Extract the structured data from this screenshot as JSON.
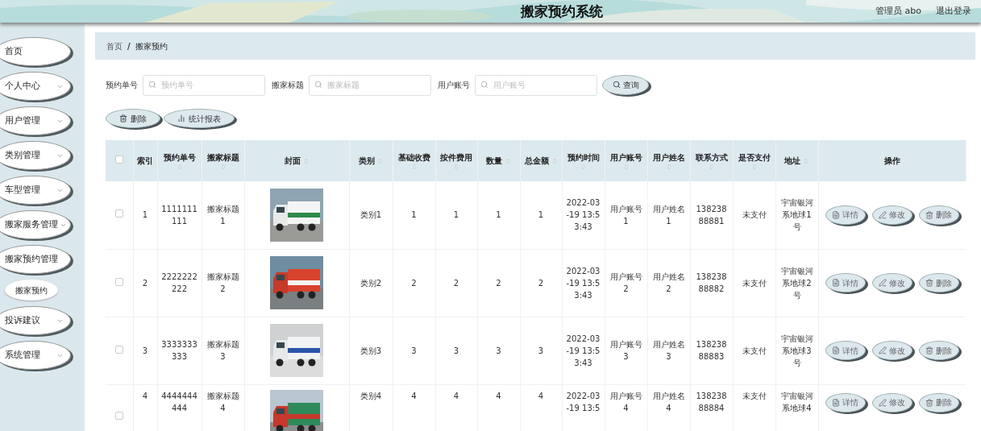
{
  "header": {
    "title": "搬家预约系统",
    "user": "管理员 abo",
    "logout": "退出登录"
  },
  "sidebar": {
    "items": [
      {
        "label": "首页",
        "kind": "link"
      },
      {
        "label": "个人中心",
        "kind": "menu",
        "expanded": false
      },
      {
        "label": "用户管理",
        "kind": "menu",
        "expanded": false
      },
      {
        "label": "类别管理",
        "kind": "menu",
        "expanded": false
      },
      {
        "label": "车型管理",
        "kind": "menu",
        "expanded": false
      },
      {
        "label": "搬家服务管理",
        "kind": "menu",
        "expanded": false
      },
      {
        "label": "搬家预约管理",
        "kind": "menu",
        "expanded": true,
        "children": [
          {
            "label": "搬家预约",
            "selected": true
          }
        ]
      },
      {
        "label": "投诉建议",
        "kind": "menu",
        "expanded": false
      },
      {
        "label": "系统管理",
        "kind": "menu",
        "expanded": false
      }
    ]
  },
  "breadcrumb": [
    "首页",
    "搬家预约"
  ],
  "breadcrumb_separator": "/",
  "search": {
    "fields": [
      {
        "label": "预约单号",
        "placeholder": "预约单号"
      },
      {
        "label": "搬家标题",
        "placeholder": "搬家标题"
      },
      {
        "label": "用户账号",
        "placeholder": "用户账号"
      }
    ],
    "button": "查询"
  },
  "toolbar": [
    {
      "label": "删除",
      "kind": "delete"
    },
    {
      "label": "统计报表",
      "kind": "chart"
    }
  ],
  "table": {
    "select_all_checked": false,
    "columns": [
      {
        "label": "索引",
        "sortable": false
      },
      {
        "label": "预约单号",
        "sortable": true
      },
      {
        "label": "搬家标题",
        "sortable": true
      },
      {
        "label": "封面",
        "sortable": true
      },
      {
        "label": "类别",
        "sortable": true
      },
      {
        "label": "基础收费",
        "sortable": true
      },
      {
        "label": "按件费用",
        "sortable": true
      },
      {
        "label": "数量",
        "sortable": true
      },
      {
        "label": "总金额",
        "sortable": true
      },
      {
        "label": "预约时间",
        "sortable": true
      },
      {
        "label": "用户账号",
        "sortable": true
      },
      {
        "label": "用户姓名",
        "sortable": true
      },
      {
        "label": "联系方式",
        "sortable": true
      },
      {
        "label": "是否支付",
        "sortable": true
      },
      {
        "label": "地址",
        "sortable": true
      },
      {
        "label": "操作",
        "sortable": false
      }
    ],
    "rows": [
      {
        "checked": false,
        "cells": [
          "1",
          "1111111111",
          "搬家标题1",
          {
            "kind": "picture"
          },
          "类别1",
          "1",
          "1",
          "1",
          "1",
          "2022-03-19 13:53:43",
          "用户账号1",
          "用户姓名1",
          "13823888881",
          "未支付",
          "宇宙银河系地球1号"
        ],
        "actions": [
          {
            "label": "详情",
            "kind": "detail"
          },
          {
            "label": "修改",
            "kind": "edit"
          },
          {
            "label": "删除",
            "kind": "delete"
          }
        ]
      },
      {
        "checked": false,
        "cells": [
          "2",
          "2222222222",
          "搬家标题2",
          {
            "kind": "picture"
          },
          "类别2",
          "2",
          "2",
          "2",
          "2",
          "2022-03-19 13:53:43",
          "用户账号2",
          "用户姓名2",
          "13823888882",
          "未支付",
          "宇宙银河系地球2号"
        ],
        "actions": [
          {
            "label": "详情",
            "kind": "detail"
          },
          {
            "label": "修改",
            "kind": "edit"
          },
          {
            "label": "删除",
            "kind": "delete"
          }
        ]
      },
      {
        "checked": false,
        "cells": [
          "3",
          "3333333333",
          "搬家标题3",
          {
            "kind": "picture"
          },
          "类别3",
          "3",
          "3",
          "3",
          "3",
          "2022-03-19 13:53:43",
          "用户账号3",
          "用户姓名3",
          "13823888883",
          "未支付",
          "宇宙银河系地球3号"
        ],
        "actions": [
          {
            "label": "详情",
            "kind": "detail"
          },
          {
            "label": "修改",
            "kind": "edit"
          },
          {
            "label": "删除",
            "kind": "delete"
          }
        ]
      },
      {
        "checked": false,
        "cells": [
          "4",
          "4444444444",
          "搬家标题4",
          {
            "kind": "picture"
          },
          "类别4",
          "4",
          "4",
          "4",
          "4",
          "2022-03-19 13:5",
          "用户账号4",
          "用户姓名4",
          "13823888884",
          "未支付",
          "宇宙银河系地球4"
        ],
        "actions": [
          {
            "label": "详情",
            "kind": "detail"
          },
          {
            "label": "修改",
            "kind": "edit"
          },
          {
            "label": "删除",
            "kind": "delete"
          }
        ]
      }
    ]
  }
}
